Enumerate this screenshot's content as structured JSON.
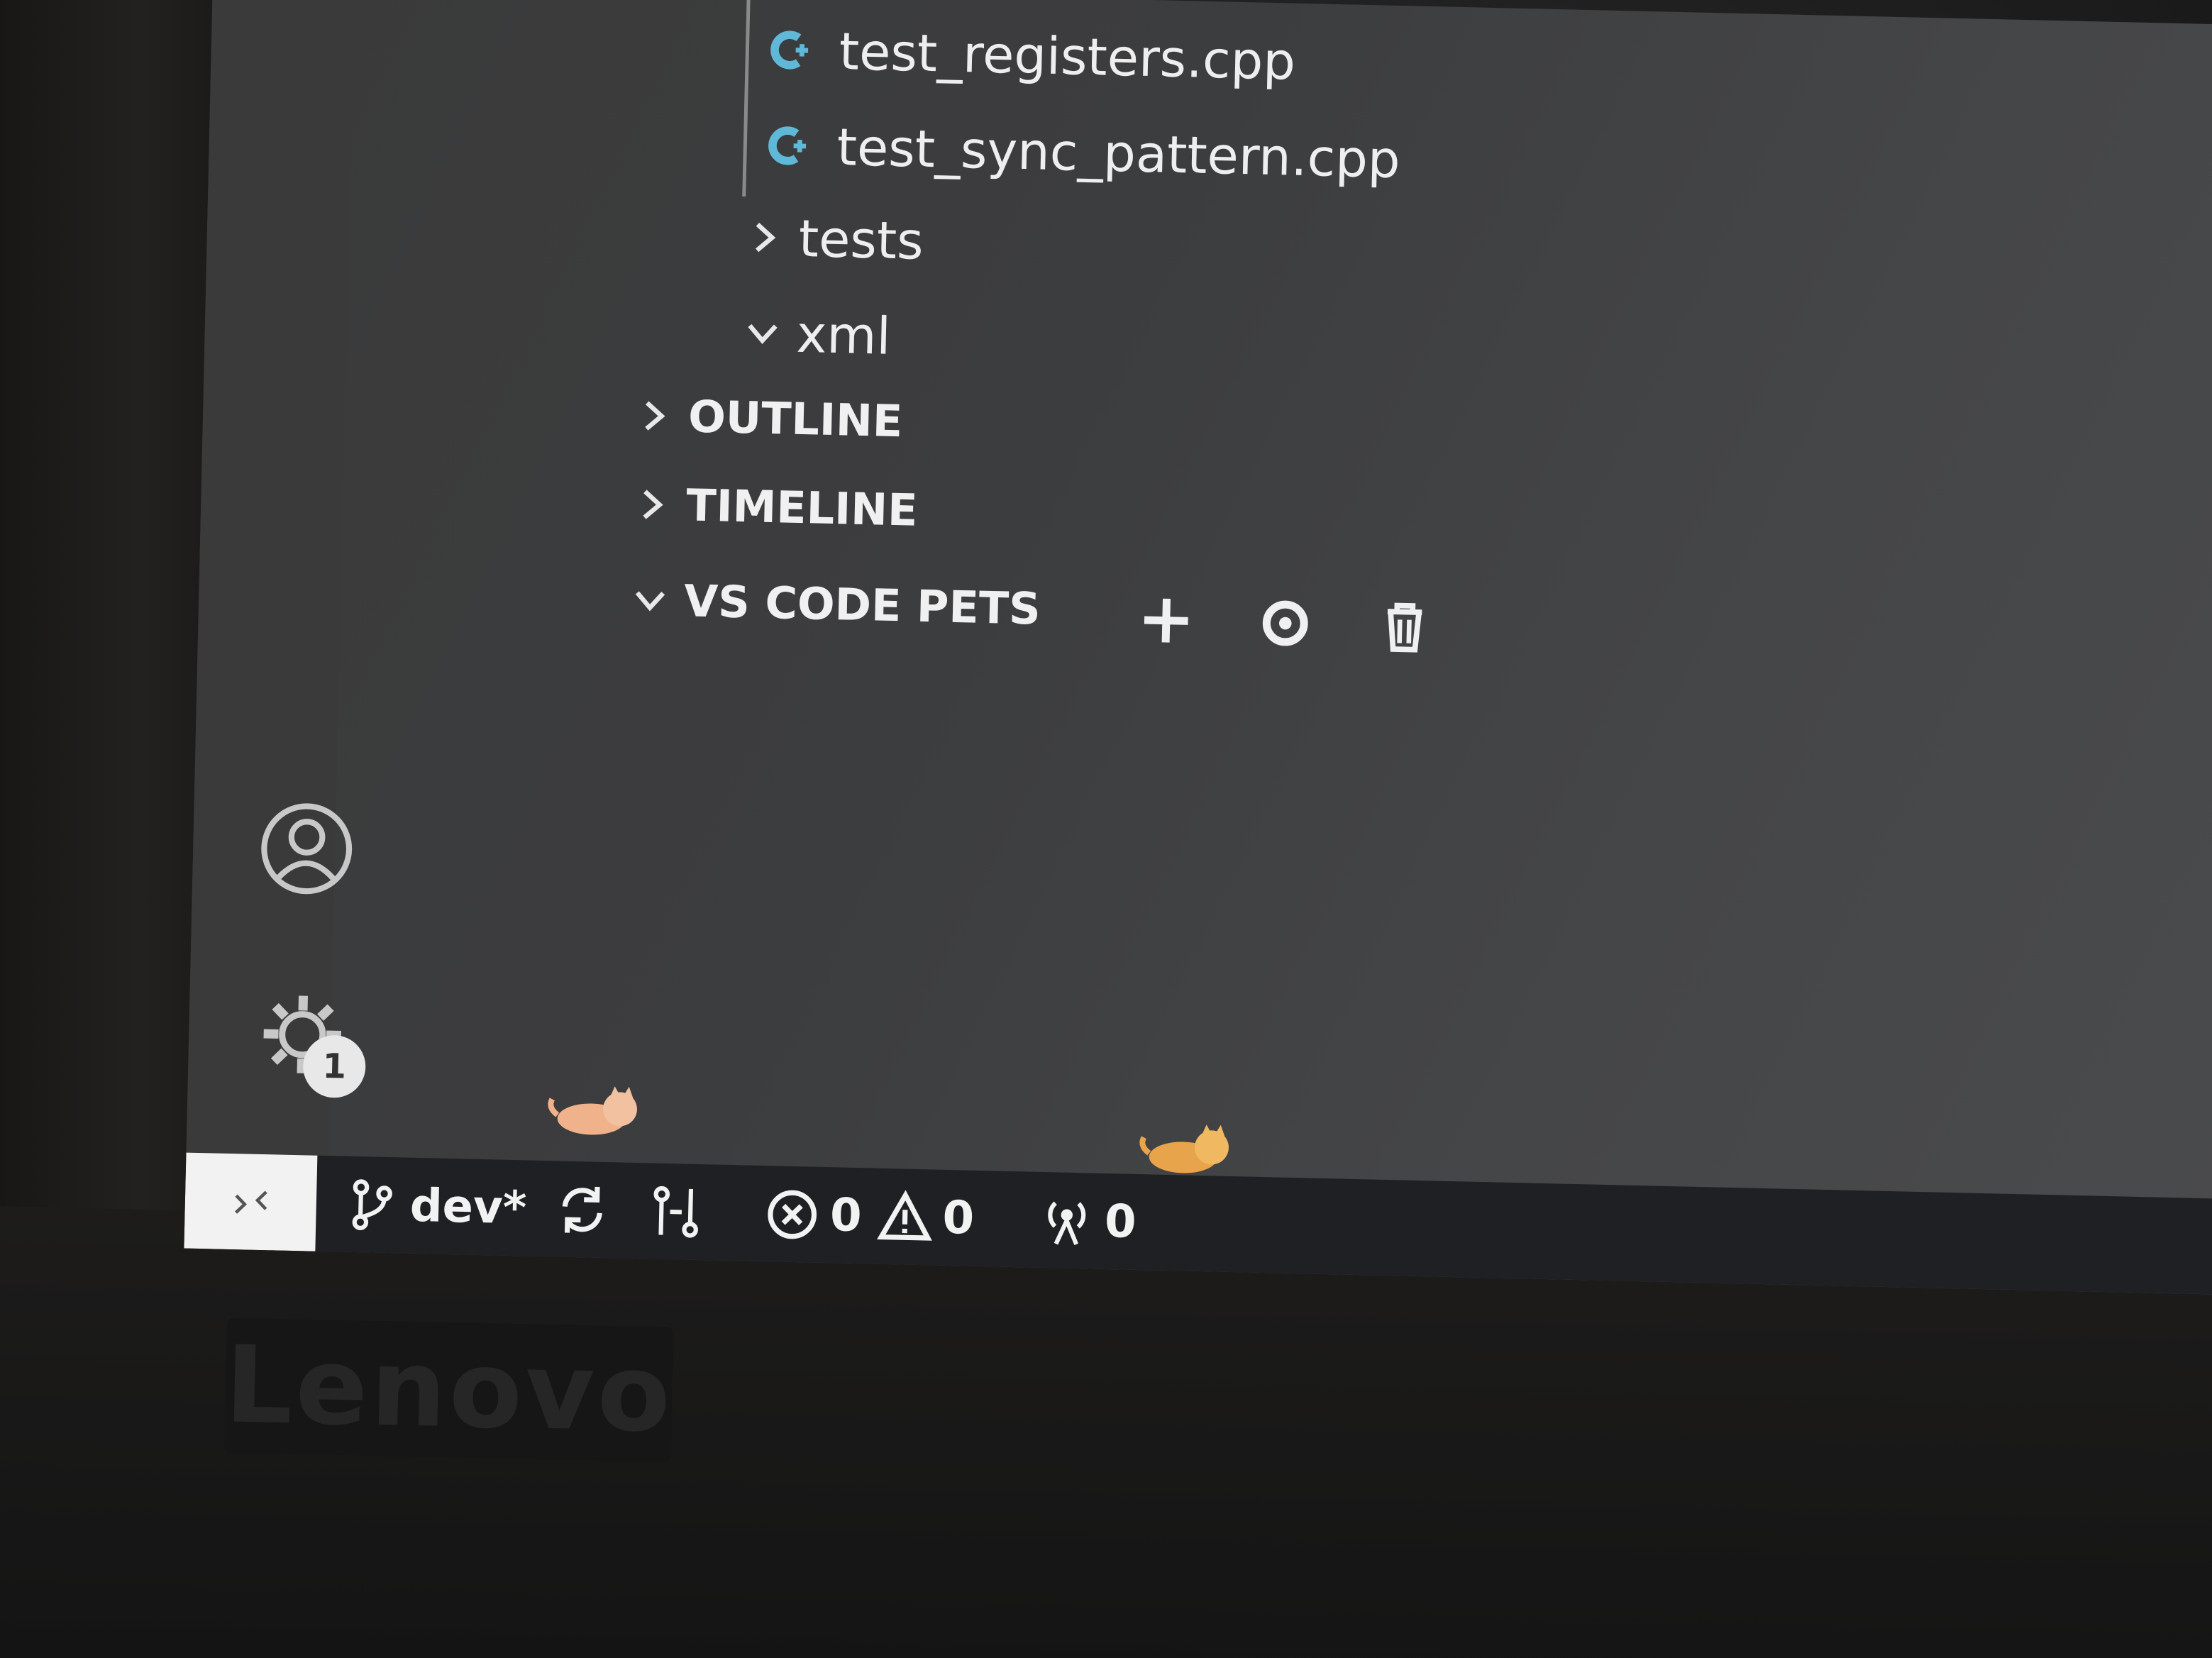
{
  "explorer": {
    "files": [
      {
        "name": "test_registers.cpp",
        "icon": "cpp-file-icon"
      },
      {
        "name": "test_sync_pattern.cpp",
        "icon": "cpp-file-icon"
      }
    ],
    "folders": [
      {
        "name": "tests",
        "state": "collapsed"
      },
      {
        "name": "xml",
        "state": "expanded"
      }
    ]
  },
  "sections": {
    "outline": {
      "label": "OUTLINE",
      "state": "collapsed"
    },
    "timeline": {
      "label": "TIMELINE",
      "state": "collapsed"
    },
    "pets": {
      "label": "VS CODE PETS",
      "state": "expanded",
      "actions": [
        "add-icon",
        "circle-dot-icon",
        "trash-icon"
      ]
    }
  },
  "activity_bar": {
    "settings_badge": "1"
  },
  "statusbar": {
    "branch": "dev*",
    "errors": "0",
    "warnings": "0",
    "ports": "0"
  },
  "bezel": {
    "logo": "Lenovo"
  },
  "colors": {
    "cpp_icon": "#5fb8d8",
    "sidebar_bg": "#3c3d3f",
    "statusbar_bg": "#1f2023",
    "text": "#eeeeee"
  }
}
